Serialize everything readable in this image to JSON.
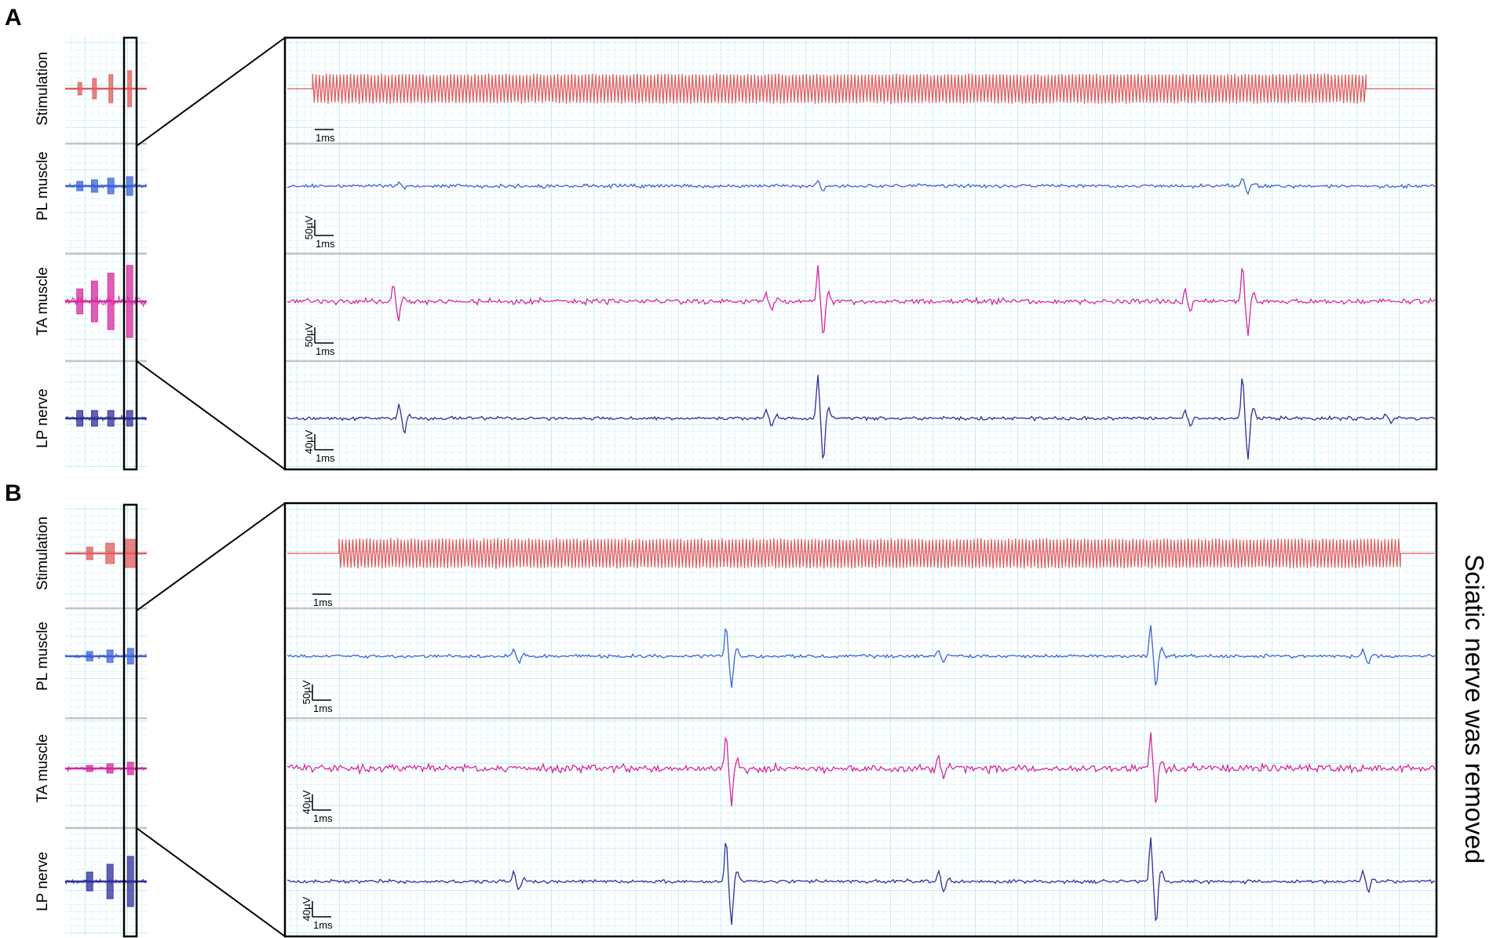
{
  "chart_data": [
    {
      "type": "line",
      "panel_label": "A",
      "channels": [
        {
          "name": "Stimulation",
          "color": "#e05a5a",
          "scale_time": "1ms",
          "scale_amp": "",
          "zoom_spikes": []
        },
        {
          "name": "PL muscle",
          "color": "#3b62d6",
          "scale_time": "1ms",
          "scale_amp": "50µV",
          "zoom_spikes": [
            {
              "t": 0.1,
              "a": 0.15
            },
            {
              "t": 0.465,
              "a": 0.45
            },
            {
              "t": 0.835,
              "a": 0.55
            }
          ]
        },
        {
          "name": "TA muscle",
          "color": "#d4289f",
          "scale_time": "1ms",
          "scale_amp": "50µV",
          "zoom_spikes": [
            {
              "t": 0.095,
              "a": 0.5
            },
            {
              "t": 0.42,
              "a": 0.25
            },
            {
              "t": 0.465,
              "a": 1.0
            },
            {
              "t": 0.785,
              "a": 0.3
            },
            {
              "t": 0.835,
              "a": 1.0
            }
          ]
        },
        {
          "name": "LP nerve",
          "color": "#2e2e9a",
          "scale_time": "1ms",
          "scale_amp": "40µV",
          "zoom_spikes": [
            {
              "t": 0.1,
              "a": 0.35
            },
            {
              "t": 0.42,
              "a": 0.2
            },
            {
              "t": 0.465,
              "a": 1.0
            },
            {
              "t": 0.785,
              "a": 0.2
            },
            {
              "t": 0.835,
              "a": 1.0
            },
            {
              "t": 0.96,
              "a": 0.1
            }
          ]
        }
      ],
      "overview_bursts": [
        0.18,
        0.36,
        0.56,
        0.79
      ],
      "stim_window": [
        0.022,
        0.94
      ]
    },
    {
      "type": "line",
      "panel_label": "B",
      "side_note": "Sciatic nerve was removed",
      "channels": [
        {
          "name": "Stimulation",
          "color": "#e05a5a",
          "scale_time": "1ms",
          "scale_amp": "",
          "zoom_spikes": []
        },
        {
          "name": "PL muscle",
          "color": "#3b62d6",
          "scale_time": "1ms",
          "scale_amp": "50µV",
          "zoom_spikes": [
            {
              "t": 0.2,
              "a": 0.2
            },
            {
              "t": 0.385,
              "a": 1.0
            },
            {
              "t": 0.57,
              "a": 0.2
            },
            {
              "t": 0.755,
              "a": 1.0
            },
            {
              "t": 0.94,
              "a": 0.25
            }
          ]
        },
        {
          "name": "TA muscle",
          "color": "#d4289f",
          "scale_time": "1ms",
          "scale_amp": "40µV",
          "zoom_spikes": [
            {
              "t": 0.385,
              "a": 1.0
            },
            {
              "t": 0.57,
              "a": 0.3
            },
            {
              "t": 0.755,
              "a": 1.0
            }
          ]
        },
        {
          "name": "LP nerve",
          "color": "#2e2e9a",
          "scale_time": "1ms",
          "scale_amp": "40µV",
          "zoom_spikes": [
            {
              "t": 0.2,
              "a": 0.2
            },
            {
              "t": 0.385,
              "a": 1.0
            },
            {
              "t": 0.57,
              "a": 0.25
            },
            {
              "t": 0.755,
              "a": 1.0
            },
            {
              "t": 0.94,
              "a": 0.25
            }
          ]
        }
      ],
      "overview_bursts": [
        0.3,
        0.55,
        0.8
      ],
      "stim_window": [
        0.045,
        0.97
      ]
    }
  ]
}
